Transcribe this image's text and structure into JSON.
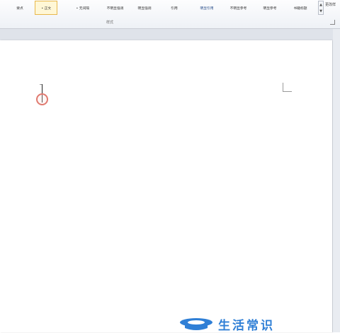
{
  "ribbon": {
    "styles": [
      {
        "label": "要点"
      },
      {
        "label": "• 正文"
      },
      {
        "label": "• 无间隔"
      },
      {
        "label": "不明显强调"
      },
      {
        "label": "明显强调"
      },
      {
        "label": "引用"
      },
      {
        "label": "明显引用"
      },
      {
        "label": "不明显参考"
      },
      {
        "label": "明显参考"
      },
      {
        "label": "书籍标题"
      }
    ],
    "selected_style": "• 正文",
    "scroll_up": "▲",
    "scroll_down": "▼",
    "more_styles": "更改样",
    "group_label": "样式"
  },
  "watermark": {
    "text": "生活常识",
    "brand_color": "#2f7fd6"
  }
}
